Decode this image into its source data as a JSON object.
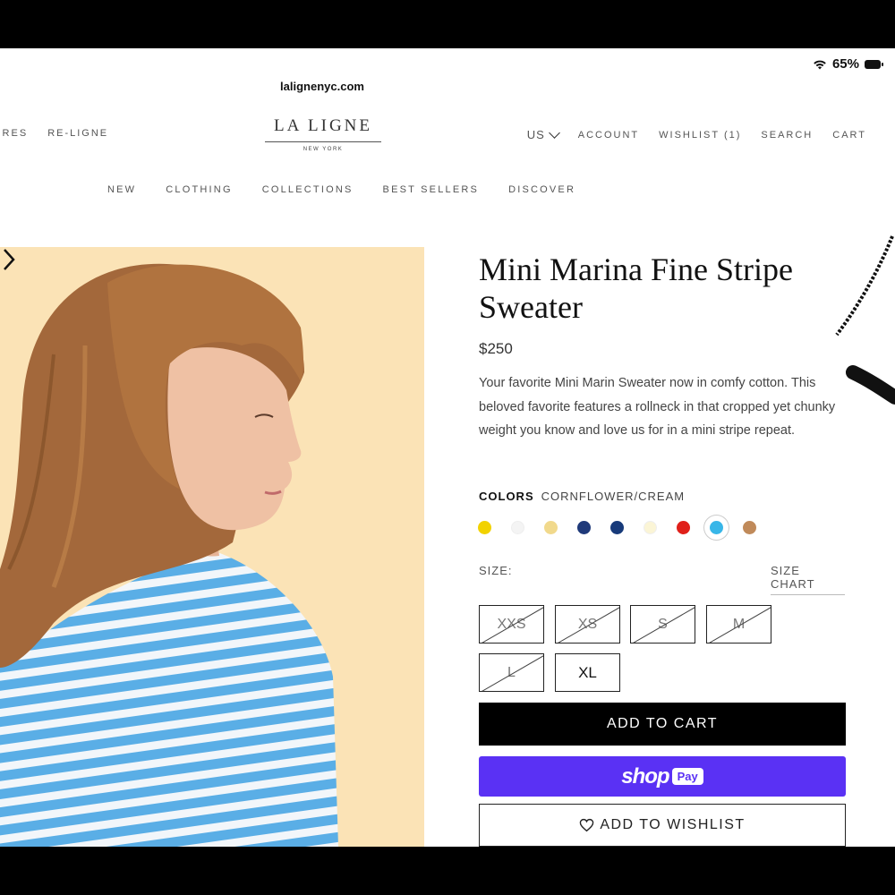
{
  "status": {
    "battery": "65%"
  },
  "browser": {
    "url": "lalignenyc.com"
  },
  "header": {
    "logo": "LA LIGNE",
    "logo_sub": "NEW YORK",
    "left_nav": [
      "ORES",
      "RE-LIGNE"
    ],
    "country": "US",
    "right_nav": [
      "ACCOUNT",
      "WISHLIST (1)",
      "SEARCH",
      "CART"
    ]
  },
  "main_nav": [
    "NEW",
    "CLOTHING",
    "COLLECTIONS",
    "BEST SELLERS",
    "DISCOVER"
  ],
  "product": {
    "title": "Mini Marina Fine Stripe Sweater",
    "price": "$250",
    "description": "Your favorite Mini Marin Sweater now in comfy cotton. This beloved favorite features a rollneck in that cropped yet chunky weight you know and love us for in a mini stripe repeat.",
    "colors_label": "COLORS",
    "selected_color": "CORNFLOWER/CREAM",
    "swatches": [
      "#f2d200",
      "#f4f4f4",
      "#f1d98c",
      "#1f3a7a",
      "#173a7a",
      "#fbf5d6",
      "#e0201a",
      "#38b6e8",
      "#c08a5a"
    ],
    "size_label": "SIZE:",
    "size_chart": "SIZE CHART",
    "sizes": [
      {
        "label": "XXS",
        "available": false
      },
      {
        "label": "XS",
        "available": false
      },
      {
        "label": "S",
        "available": false
      },
      {
        "label": "M",
        "available": false
      },
      {
        "label": "L",
        "available": false
      },
      {
        "label": "XL",
        "available": true
      }
    ],
    "add_to_cart": "ADD TO CART",
    "shop_pay_shop": "shop",
    "shop_pay_pay": "Pay",
    "add_to_wishlist": "ADD TO WISHLIST"
  }
}
